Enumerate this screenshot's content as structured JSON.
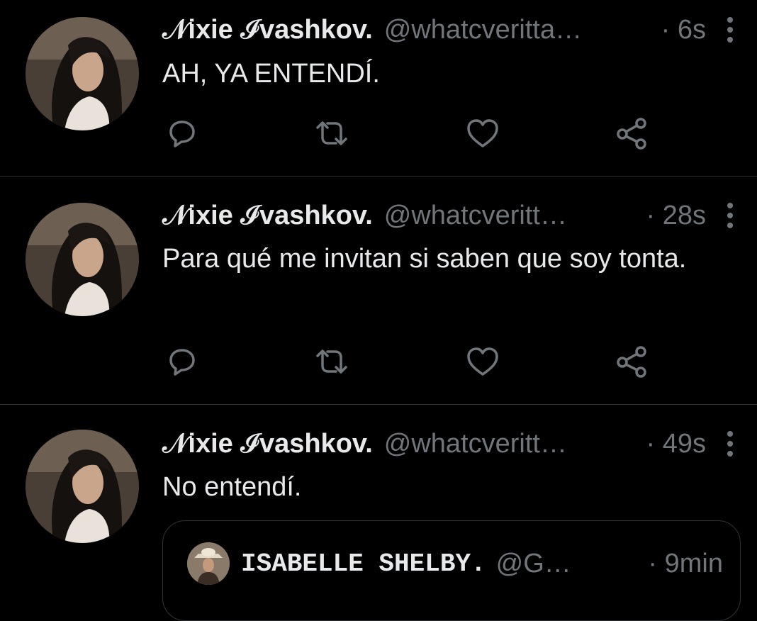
{
  "tweets": [
    {
      "name": "𝒩ixie ℐvashkov.",
      "handle": "@whatcveritta…",
      "time": "· 6s",
      "text": "AH, YA ENTENDÍ."
    },
    {
      "name": "𝒩ixie ℐvashkov.",
      "handle": "@whatcveritt…",
      "time": "· 28s",
      "text": "Para qué me invitan si saben que soy tonta."
    },
    {
      "name": "𝒩ixie ℐvashkov.",
      "handle": "@whatcveritt…",
      "time": "· 49s",
      "text": "No entendí.",
      "quote": {
        "name": "ISABELLE SHELBY.",
        "handle": "@G…",
        "time": "· 9min"
      }
    }
  ],
  "icons": {
    "reply": "reply-icon",
    "retweet": "retweet-icon",
    "like": "heart-icon",
    "share": "share-icon",
    "more": "more-vertical-icon"
  },
  "colors": {
    "background": "#000000",
    "text": "#e7e9ea",
    "secondary": "#71767b",
    "divider": "#2f3336"
  }
}
